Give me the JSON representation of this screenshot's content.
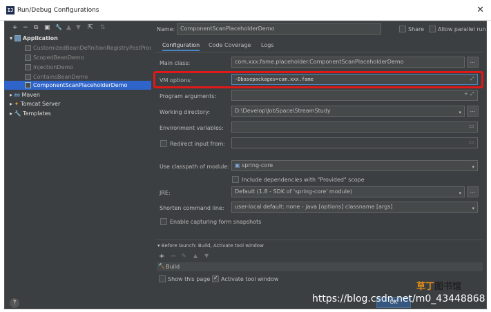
{
  "window": {
    "title": "Run/Debug Configurations",
    "app_icon_text": "IJ"
  },
  "toolbar": [
    "+",
    "−",
    "⧉",
    "▣",
    "🔧",
    "▲",
    "▼",
    "⇱",
    "⇅"
  ],
  "tree": {
    "application_label": "Application",
    "items": [
      "CustomizedBeanDefinitionRegistryPostProce",
      "ScopedBeanDemo",
      "InjectionDemo",
      "ContainsBeanDemo",
      "ComponentScanPlaceholderDemo"
    ],
    "maven_label": "Maven",
    "tomcat_label": "Tomcat Server",
    "templates_label": "Templates"
  },
  "header": {
    "name_label": "Name:",
    "name_value": "ComponentScanPlaceholderDemo",
    "share_label": "Share",
    "parallel_label": "Allow parallel run"
  },
  "tabs": [
    "Configuration",
    "Code Coverage",
    "Logs"
  ],
  "form": {
    "main_class_label": "Main class:",
    "main_class_value": "com.xxx.fame.placeholder.ComponentScanPlaceholderDemo",
    "vm_options_label": "VM options:",
    "vm_options_value": "-Dbasepackages=com.xxx.fame",
    "program_args_label": "Program arguments:",
    "working_dir_label": "Working directory:",
    "working_dir_value": "D:\\Develop\\JobSpace\\StreamStudy",
    "env_vars_label": "Environment variables:",
    "redirect_label": "Redirect input from:",
    "classpath_label": "Use classpath of module:",
    "classpath_value": "spring-core",
    "include_provided_label": "Include dependencies with \"Provided\" scope",
    "jre_label": "JRE:",
    "jre_value": "Default (1.8 - SDK of 'spring-core' module)",
    "shorten_label": "Shorten command line:",
    "shorten_value": "user-local default: none - java [options] classname [args]",
    "capture_label": "Enable capturing form snapshots"
  },
  "before_launch": {
    "title": "Before launch: Build, Activate tool window",
    "build_label": "Build",
    "show_page_label": "Show this page",
    "activate_label": "Activate tool window"
  },
  "footer": {
    "help": "?",
    "ok_label": "OK"
  },
  "watermark": {
    "url": "https://blog.csdn.net/m0_43448868",
    "logo": "草丁图书馆"
  },
  "colors": {
    "highlight_box": "#e01818",
    "selection": "#2f65ca",
    "panel": "#3c3f41"
  }
}
